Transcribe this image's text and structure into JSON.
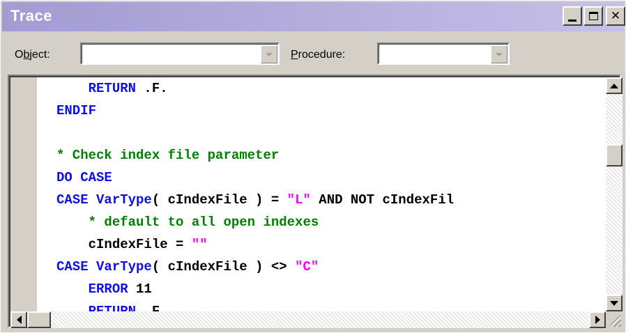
{
  "window": {
    "title": "Trace"
  },
  "toolbar": {
    "object_label_pre": "O",
    "object_label_accel": "b",
    "object_label_post": "ject:",
    "object_value": "",
    "procedure_label_pre": "",
    "procedure_label_accel": "P",
    "procedure_label_post": "rocedure:",
    "procedure_value": ""
  },
  "colors": {
    "keyword": "#1010e0",
    "text": "#000000",
    "comment": "#008000",
    "string": "#ff00ff",
    "titlebar_start": "#a39bd2",
    "titlebar_end": "#c4c0e8"
  },
  "code": {
    "lines": [
      {
        "indent": "    ",
        "tokens": [
          {
            "t": "kw",
            "v": "RETURN"
          },
          {
            "t": "tx",
            "v": " .F."
          }
        ]
      },
      {
        "indent": "",
        "tokens": [
          {
            "t": "kw",
            "v": "ENDIF"
          }
        ]
      },
      {
        "indent": "",
        "tokens": []
      },
      {
        "indent": "",
        "tokens": [
          {
            "t": "cm",
            "v": "* Check index file parameter"
          }
        ]
      },
      {
        "indent": "",
        "tokens": [
          {
            "t": "kw",
            "v": "DO CASE"
          }
        ]
      },
      {
        "indent": "",
        "tokens": [
          {
            "t": "kw",
            "v": "CASE VarType"
          },
          {
            "t": "tx",
            "v": "( cIndexFile ) = "
          },
          {
            "t": "st",
            "v": "\"L\""
          },
          {
            "t": "tx",
            "v": " AND NOT cIndexFil"
          }
        ]
      },
      {
        "indent": "    ",
        "tokens": [
          {
            "t": "cm",
            "v": "* default to all open indexes"
          }
        ]
      },
      {
        "indent": "    ",
        "tokens": [
          {
            "t": "tx",
            "v": "cIndexFile = "
          },
          {
            "t": "st",
            "v": "\"\""
          }
        ]
      },
      {
        "indent": "",
        "tokens": [
          {
            "t": "kw",
            "v": "CASE VarType"
          },
          {
            "t": "tx",
            "v": "( cIndexFile ) <> "
          },
          {
            "t": "st",
            "v": "\"C\""
          }
        ]
      },
      {
        "indent": "    ",
        "tokens": [
          {
            "t": "kw",
            "v": "ERROR"
          },
          {
            "t": "tx",
            "v": " 11"
          }
        ]
      },
      {
        "indent": "    ",
        "tokens": [
          {
            "t": "kw",
            "v": "RETURN"
          },
          {
            "t": "tx",
            "v": " .F."
          }
        ]
      }
    ]
  }
}
